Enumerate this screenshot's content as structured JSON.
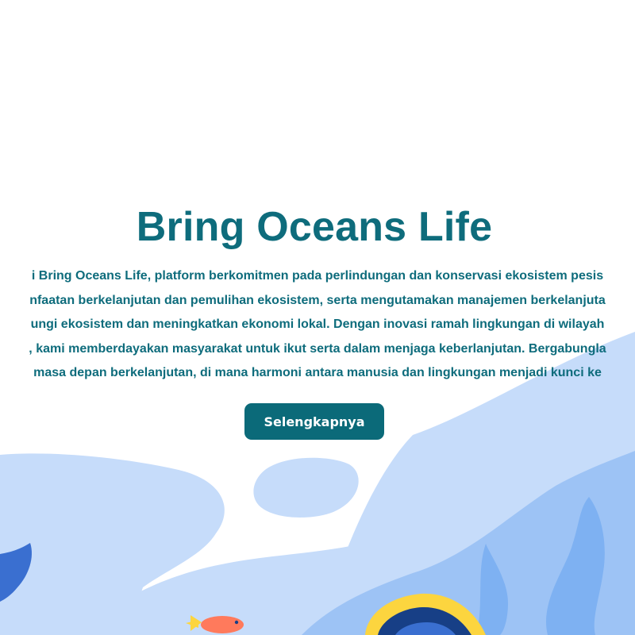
{
  "hero": {
    "title": "Bring Oceans Life",
    "description_lines": [
      "i Bring Oceans Life, platform berkomitmen pada perlindungan dan konservasi ekosistem pesis",
      "nfaatan berkelanjutan dan pemulihan ekosistem, serta mengutamakan manajemen berkelanjuta",
      "ungi ekosistem dan meningkatkan ekonomi lokal. Dengan inovasi ramah lingkungan di wilayah",
      ", kami memberdayakan masyarakat untuk ikut serta dalam menjaga keberlanjutan. Bergabungla",
      "masa depan berkelanjutan, di mana harmoni antara manusia dan lingkungan menjadi kunci ke"
    ],
    "cta_label": "Selengkapnya"
  },
  "colors": {
    "brand": "#0e6c7c",
    "button": "#0b6a79",
    "wave_light": "#c6dcfa",
    "wave_mid": "#9dc3f5",
    "seaweed": "#7eb1f2",
    "whale": "#3a6fd0",
    "fish_orange": "#ff7a5c",
    "fish_yellow": "#fcd53f",
    "fish_navy": "#173f86"
  },
  "illustration": {
    "icons": [
      "wave-icon",
      "whale-tail-icon",
      "fish-icon",
      "tang-fish-icon",
      "seaweed-icon"
    ]
  }
}
